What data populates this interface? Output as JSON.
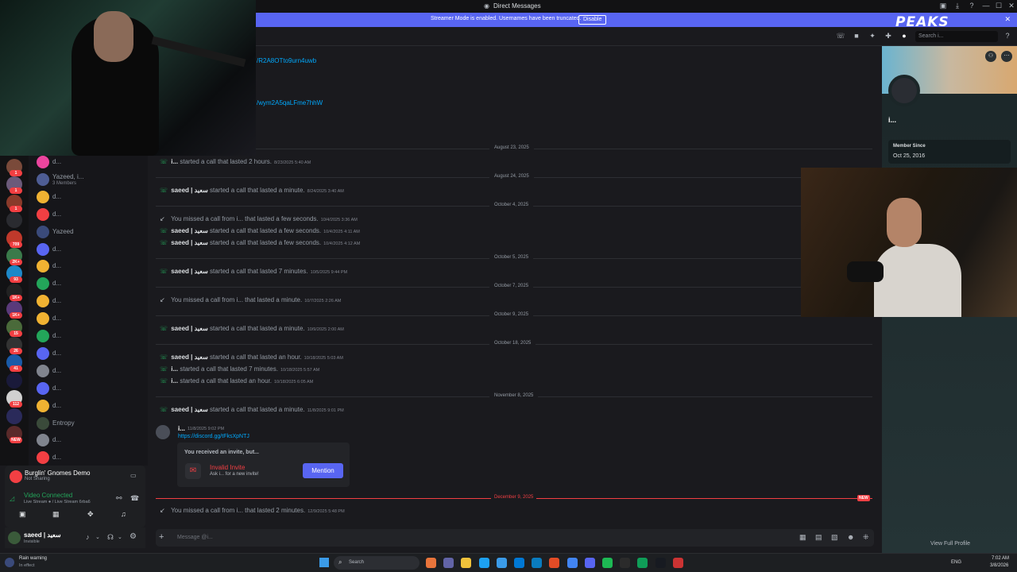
{
  "window": {
    "title": "Direct Messages",
    "controls": [
      "—",
      "☐",
      "✕"
    ]
  },
  "banner": {
    "message": "Streamer Mode is enabled. Usernames have been truncated.",
    "button": "Disable"
  },
  "header": {
    "search_placeholder": "Search i..."
  },
  "stream_overlay": {
    "logo": "PEAKS"
  },
  "servers": [
    {
      "badge": "1",
      "color": "#7a4a3a"
    },
    {
      "badge": "1",
      "color": "#6b5a7a"
    },
    {
      "badge": "1",
      "color": "#8a3a2a"
    },
    {
      "badge": "",
      "color": "#2a2b30"
    },
    {
      "badge": "709",
      "color": "#c0392b"
    },
    {
      "badge": "2K+",
      "color": "#3a7a4a"
    },
    {
      "badge": "93",
      "color": "#1e88c8"
    },
    {
      "badge": "1K+",
      "color": "#222"
    },
    {
      "badge": "1K+",
      "color": "#5a3a7a"
    },
    {
      "badge": "15",
      "color": "#4a6a3a"
    },
    {
      "badge": "26",
      "color": "#333"
    },
    {
      "badge": "41",
      "color": "#1a5aa8"
    },
    {
      "badge": "",
      "color": "#1a1a3a"
    },
    {
      "badge": "112",
      "color": "#d0d0d0"
    },
    {
      "badge": "",
      "color": "#2a2a5a"
    },
    {
      "badge": "NEW",
      "color": "#5a2a2a"
    }
  ],
  "dms": [
    {
      "name": "d...",
      "sub": "",
      "color": "#eb459e"
    },
    {
      "name": "Yazeed, i...",
      "sub": "3 Members",
      "color": "#4e5d94"
    },
    {
      "name": "d...",
      "sub": "",
      "color": "#f0b232"
    },
    {
      "name": "d...",
      "sub": "",
      "color": "#f23f43"
    },
    {
      "name": "Yazeed",
      "sub": "",
      "color": "#3a4a7a"
    },
    {
      "name": "d...",
      "sub": "",
      "color": "#5865f2"
    },
    {
      "name": "d...",
      "sub": "",
      "color": "#f0b232"
    },
    {
      "name": "d...",
      "sub": "",
      "color": "#23a55a"
    },
    {
      "name": "d...",
      "sub": "",
      "color": "#f0b232"
    },
    {
      "name": "d...",
      "sub": "",
      "color": "#f0b232"
    },
    {
      "name": "d...",
      "sub": "",
      "color": "#23a55a"
    },
    {
      "name": "d...",
      "sub": "",
      "color": "#5865f2"
    },
    {
      "name": "d...",
      "sub": "",
      "color": "#80848e"
    },
    {
      "name": "d...",
      "sub": "",
      "color": "#5865f2"
    },
    {
      "name": "d...",
      "sub": "",
      "color": "#f0b232"
    },
    {
      "name": "Entropy",
      "sub": "",
      "color": "#3a4a3a"
    },
    {
      "name": "d...",
      "sub": "",
      "color": "#80848e"
    },
    {
      "name": "d...",
      "sub": "",
      "color": "#f23f43"
    }
  ],
  "activity": {
    "game": "Burglin' Gnomes Demo",
    "game_status": "Not Sharing",
    "voice": "Video Connected",
    "voice_sub": "Live Stream ● / Live Stream 6rba6"
  },
  "user": {
    "name": "saeed | سعيد",
    "status": "Invisible"
  },
  "chat": {
    "links": [
      "/R2A8OTto9urn4uwb",
      "/wym2A5qaLFme7hhW"
    ],
    "dates": [
      "August 23, 2025",
      "August 24, 2025",
      "October 4, 2025",
      "October 5, 2025",
      "October 7, 2025",
      "October 9, 2025",
      "October 18, 2025",
      "November 8, 2025",
      "December 9, 2025"
    ],
    "lines": [
      {
        "missed": false,
        "who": "i...",
        "text": "started a call that lasted 2 hours.",
        "ts": "8/23/2025 5:40 AM"
      },
      {
        "missed": false,
        "who": "saeed | سعيد",
        "text": "started a call that lasted a minute.",
        "ts": "8/24/2025 3:40 AM"
      },
      {
        "missed": true,
        "who": "",
        "text": "You missed a call from i... that lasted a few seconds.",
        "ts": "10/4/2025 3:36 AM"
      },
      {
        "missed": false,
        "who": "saeed | سعيد",
        "text": "started a call that lasted a few seconds.",
        "ts": "10/4/2025 4:11 AM"
      },
      {
        "missed": false,
        "who": "saeed | سعيد",
        "text": "started a call that lasted a few seconds.",
        "ts": "10/4/2025 4:12 AM"
      },
      {
        "missed": false,
        "who": "saeed | سعيد",
        "text": "started a call that lasted 7 minutes.",
        "ts": "10/5/2025 9:44 PM"
      },
      {
        "missed": true,
        "who": "",
        "text": "You missed a call from i... that lasted a minute.",
        "ts": "10/7/2025 2:26 AM"
      },
      {
        "missed": false,
        "who": "saeed | سعيد",
        "text": "started a call that lasted a minute.",
        "ts": "10/9/2025 2:00 AM"
      },
      {
        "missed": false,
        "who": "saeed | سعيد",
        "text": "started a call that lasted an hour.",
        "ts": "10/18/2025 5:03 AM"
      },
      {
        "missed": false,
        "who": "i...",
        "text": "started a call that lasted 7 minutes.",
        "ts": "10/18/2025 5:57 AM"
      },
      {
        "missed": false,
        "who": "i...",
        "text": "started a call that lasted an hour.",
        "ts": "10/18/2025 6:05 AM"
      },
      {
        "missed": false,
        "who": "saeed | سعيد",
        "text": "started a call that lasted a minute.",
        "ts": "11/8/2025 9:01 PM"
      },
      {
        "missed": true,
        "who": "",
        "text": "You missed a call from i... that lasted 2 minutes.",
        "ts": "12/9/2025 5:48 PM"
      }
    ],
    "message": {
      "author": "i...",
      "ts": "11/8/2025 9:02 PM",
      "link": "https://discord.gg/tFksXpNTJ"
    },
    "invite": {
      "header": "You received an invite, but...",
      "title": "Invalid Invite",
      "sub": "Ask i... for a new invite!",
      "button": "Mention"
    },
    "new_badge": "NEW",
    "composer_placeholder": "Message @i..."
  },
  "profile": {
    "name": "i...",
    "member_since_label": "Member Since",
    "member_since": "Oct 25, 2016",
    "view_full": "View Full Profile"
  },
  "taskbar": {
    "weather": "Rain warning",
    "weather_sub": "In effect",
    "search": "Search",
    "lang": "ENG",
    "time": "7:02 AM",
    "date": "3/8/2026"
  },
  "colors": {
    "accent": "#5865f2",
    "green": "#23a55a",
    "red": "#f23f43",
    "link": "#00a8fc"
  }
}
